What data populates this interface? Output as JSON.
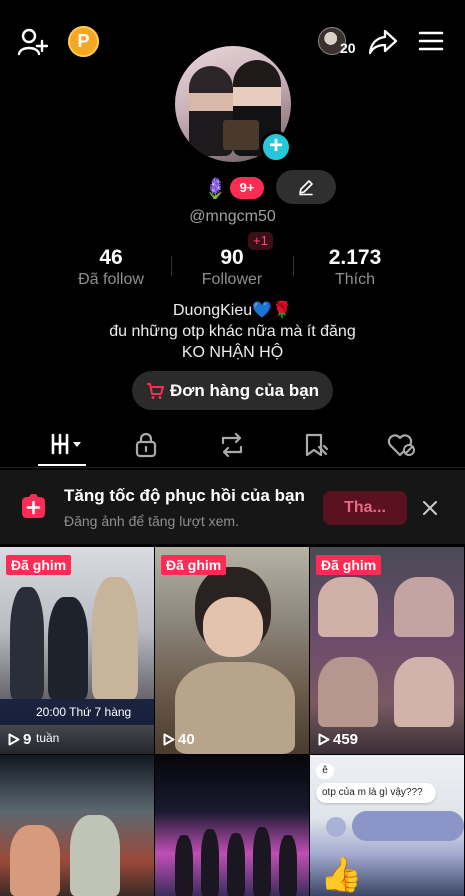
{
  "header": {
    "add_user_icon": "person-add-icon",
    "coin_label": "P",
    "mini_avatar_count": "20",
    "share_icon": "share-arrow-icon",
    "menu_icon": "hamburger-menu-icon"
  },
  "profile": {
    "flower_glyph": "🪻",
    "notif_count": "9+",
    "handle": "@mngcm50",
    "stats": [
      {
        "value": "46",
        "label": "Đã follow"
      },
      {
        "value": "90",
        "label": "Follower"
      },
      {
        "value": "2.173",
        "label": "Thích"
      }
    ],
    "follower_delta": "+1",
    "bio_lines": [
      "DuongKieu💙🌹",
      "đu những otp khác nữa mà ít đăng",
      "KO NHẬN HỘ"
    ],
    "order_button": "Đơn hàng của bạn"
  },
  "tabs": [
    {
      "icon": "videos-grid-icon",
      "active": true
    },
    {
      "icon": "lock-icon",
      "active": false
    },
    {
      "icon": "repost-icon",
      "active": false
    },
    {
      "icon": "bookmark-icon",
      "active": false
    },
    {
      "icon": "liked-heart-icon",
      "active": false
    }
  ],
  "promo": {
    "title": "Tăng tốc độ phục hồi của bạn",
    "subtitle": "Đăng ảnh để tăng lượt xem.",
    "button": "Tha...",
    "close_icon": "close-icon"
  },
  "videos": [
    {
      "pinned_label": "Đã ghim",
      "views": "9",
      "caption": "20:00 Thứ 7 hàng tuần"
    },
    {
      "pinned_label": "Đã ghim",
      "views": "40"
    },
    {
      "pinned_label": "Đã ghim",
      "views": "459"
    },
    {},
    {},
    {
      "chat_e": "ê",
      "chat_text": "otp của m là gì vậy???",
      "thumb_glyph": "👍"
    }
  ],
  "colors": {
    "accent": "#fe2c55",
    "plus_badge": "#25c7d9",
    "coin": "#f5a623",
    "background": "#000000"
  }
}
